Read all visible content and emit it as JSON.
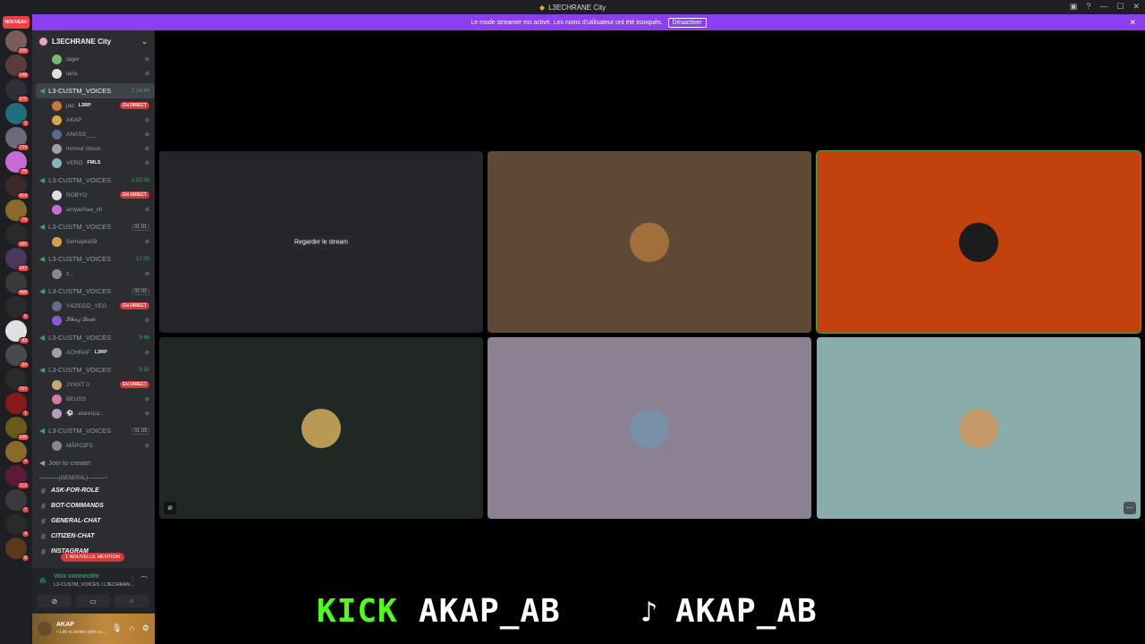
{
  "window": {
    "title": "L3ECHRANE City",
    "controls": [
      "inbox-icon",
      "help-icon",
      "minimize-icon",
      "maximize-icon",
      "close-icon"
    ]
  },
  "banner": {
    "text": "Le mode streamer est activé. Les noms d'utilisateur ont été tronqués.",
    "button_label": "Désactiver",
    "close": "✕"
  },
  "servers": {
    "nouveau_label": "NOUVEAU",
    "badges": [
      "336",
      "148",
      "275",
      "3",
      "734",
      "78",
      "414",
      "79",
      "160",
      "197",
      "468",
      "5",
      "43",
      "34",
      "157",
      "1",
      "248",
      "4",
      "112",
      "7",
      "4",
      "8"
    ]
  },
  "guild": {
    "name": "L3ECHRANE City"
  },
  "channels": {
    "top_users": [
      {
        "name": "tager"
      },
      {
        "name": "taha"
      }
    ],
    "voice": [
      {
        "name": "L3-CUSTM_VOICES",
        "timer": "1:24:44",
        "active": true,
        "users": [
          {
            "name": "jad",
            "tag": "L3RP",
            "live": "EN DIRECT"
          },
          {
            "name": "AKAP"
          },
          {
            "name": "ANASS___"
          },
          {
            "name": "mmoul zitoun"
          },
          {
            "name": "VERO",
            "tag": "FMLS"
          }
        ]
      },
      {
        "name": "L3-CUSTM_VOICES",
        "timer": "1:03:38",
        "users": [
          {
            "name": "ROBYO",
            "live": "EN DIRECT"
          },
          {
            "name": "amyachaa_ch"
          }
        ]
      },
      {
        "name": "L3-CUSTM_VOICES",
        "pill": "01 01",
        "users": [
          {
            "name": "Semayka59"
          }
        ]
      },
      {
        "name": "L3-CUSTM_VOICES",
        "timer": "17:25",
        "users": [
          {
            "name": "z..."
          }
        ]
      },
      {
        "name": "L3-CUSTM_VOICES",
        "pill": "02 02",
        "users": [
          {
            "name": "Y4ZIDDD_YEG",
            "live": "EN DIRECT"
          },
          {
            "name": "𝓛𝓱𝓪𝓳 𝓓𝓸𝓭𝓸"
          }
        ]
      },
      {
        "name": "L3-CUSTM_VOICES",
        "timer": "9:46",
        "users": [
          {
            "name": "ACHRAF",
            "tag": "L3RP"
          }
        ]
      },
      {
        "name": "L3-CUSTM_VOICES",
        "timer": "9:30",
        "users": [
          {
            "name": "JYNXT 0",
            "live": "EN DIRECT"
          },
          {
            "name": "BEUSS"
          },
          {
            "name": "⚽ .:ɕlareηcɛ:."
          }
        ]
      },
      {
        "name": "L3-CUSTM_VOICES",
        "pill": "01 03",
        "users": [
          {
            "name": "MÂRCØ'S"
          }
        ]
      }
    ],
    "join_to_create": "Join to create!",
    "category": "⌐———{GENERAL}———¬",
    "text_channels": [
      {
        "name": "ASK-FOR-ROLE"
      },
      {
        "name": "BOT-COMMANDS"
      },
      {
        "name": "GENERAL-CHAT"
      },
      {
        "name": "CITIZEN-CHAT"
      },
      {
        "name": "INSTAGRAM"
      }
    ],
    "mention_pill": "1 NOUVELLE MENTION"
  },
  "voice_panel": {
    "status": "Voix connectée",
    "channel": "L3-CUSTM_VOICES / L3ECHRAN...",
    "buttons": [
      "camera-off",
      "screen-share",
      "activities"
    ]
  },
  "user_panel": {
    "name": "AKAP",
    "status": "• Life is better with m..."
  },
  "stage": {
    "tiles": [
      {
        "kind": "stream",
        "label": "Regarder le stream",
        "bg": "#23252a"
      },
      {
        "kind": "avatar",
        "bg": "#5d4935",
        "avatar_color": "#a0703a"
      },
      {
        "kind": "avatar",
        "bg": "#c2410c",
        "avatar_color": "#1c1c1c"
      },
      {
        "kind": "avatar",
        "bg": "#212824",
        "avatar_color": "#b89a55"
      },
      {
        "kind": "avatar",
        "bg": "#8c8093",
        "avatar_color": "#7a8fa8"
      },
      {
        "kind": "avatar",
        "bg": "#8aadab",
        "avatar_color": "#c59a6a"
      }
    ]
  },
  "overlay": {
    "kick_word": "KICK",
    "kick_handle": "AKAP_AB",
    "tiktok_handle": "AKAP_AB",
    "kick_color": "#53fc18",
    "text_color": "#ffffff"
  }
}
